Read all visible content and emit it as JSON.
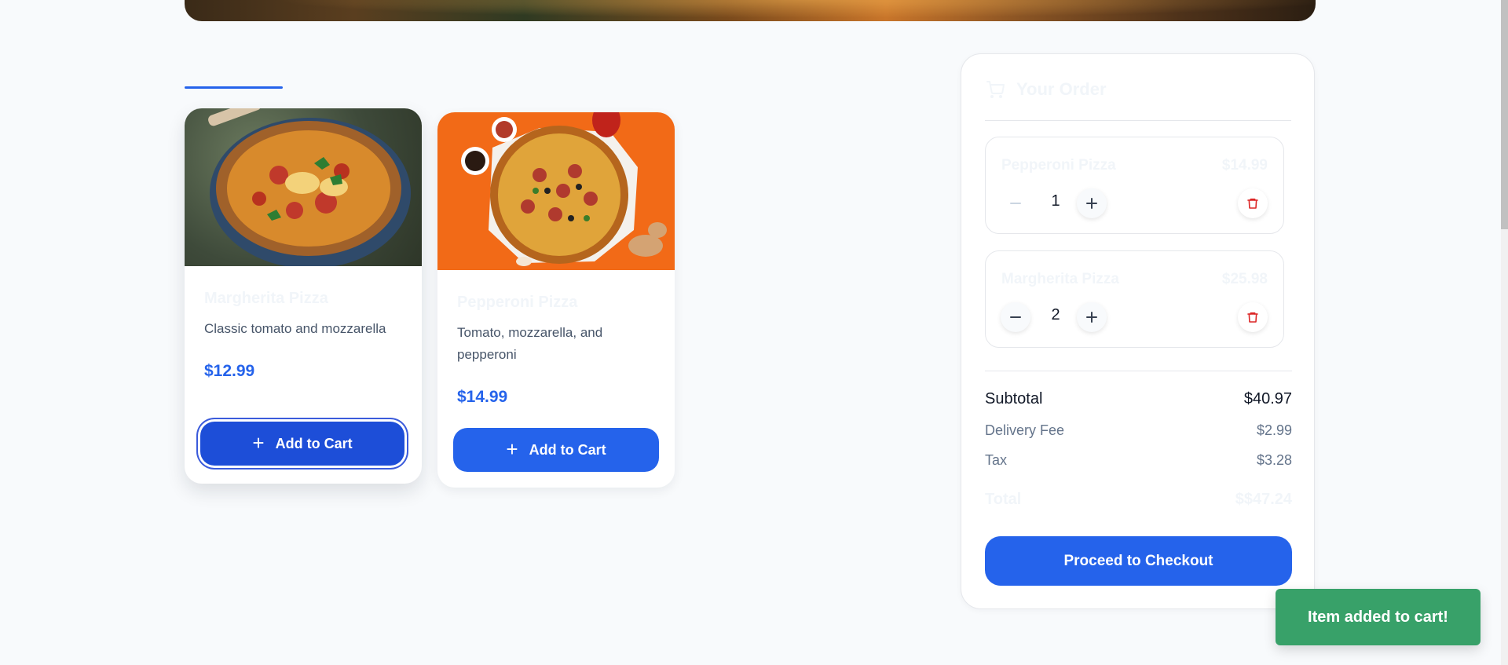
{
  "menu": {
    "section_title": "",
    "items": [
      {
        "name": "Margherita Pizza",
        "description": "Classic tomato and mozzarella",
        "price": "$12.99",
        "button_label": "Add to Cart"
      },
      {
        "name": "Pepperoni Pizza",
        "description": "Tomato, mozzarella, and pepperoni",
        "price": "$14.99",
        "button_label": "Add to Cart"
      }
    ]
  },
  "order": {
    "title": "Your Order",
    "items": [
      {
        "name": "Pepperoni Pizza",
        "price": "$14.99",
        "quantity": "1"
      },
      {
        "name": "Margherita Pizza",
        "price": "$25.98",
        "quantity": "2"
      }
    ],
    "subtotal_label": "Subtotal",
    "subtotal_value": "$40.97",
    "delivery_label": "Delivery Fee",
    "delivery_value": "$2.99",
    "tax_label": "Tax",
    "tax_value": "$3.28",
    "total_label": "Total",
    "total_value": "$$47.24",
    "checkout_label": "Proceed to Checkout"
  },
  "toast": {
    "message": "Item added to cart!"
  },
  "icons": {
    "cart": "shopping-cart-icon",
    "plus": "plus-icon",
    "minus": "minus-icon",
    "trash": "trash-icon"
  },
  "colors": {
    "primary": "#2563eb",
    "primary_active": "#1d4ed8",
    "danger": "#dc2626",
    "success": "#38a169",
    "background": "#f8fafc"
  }
}
